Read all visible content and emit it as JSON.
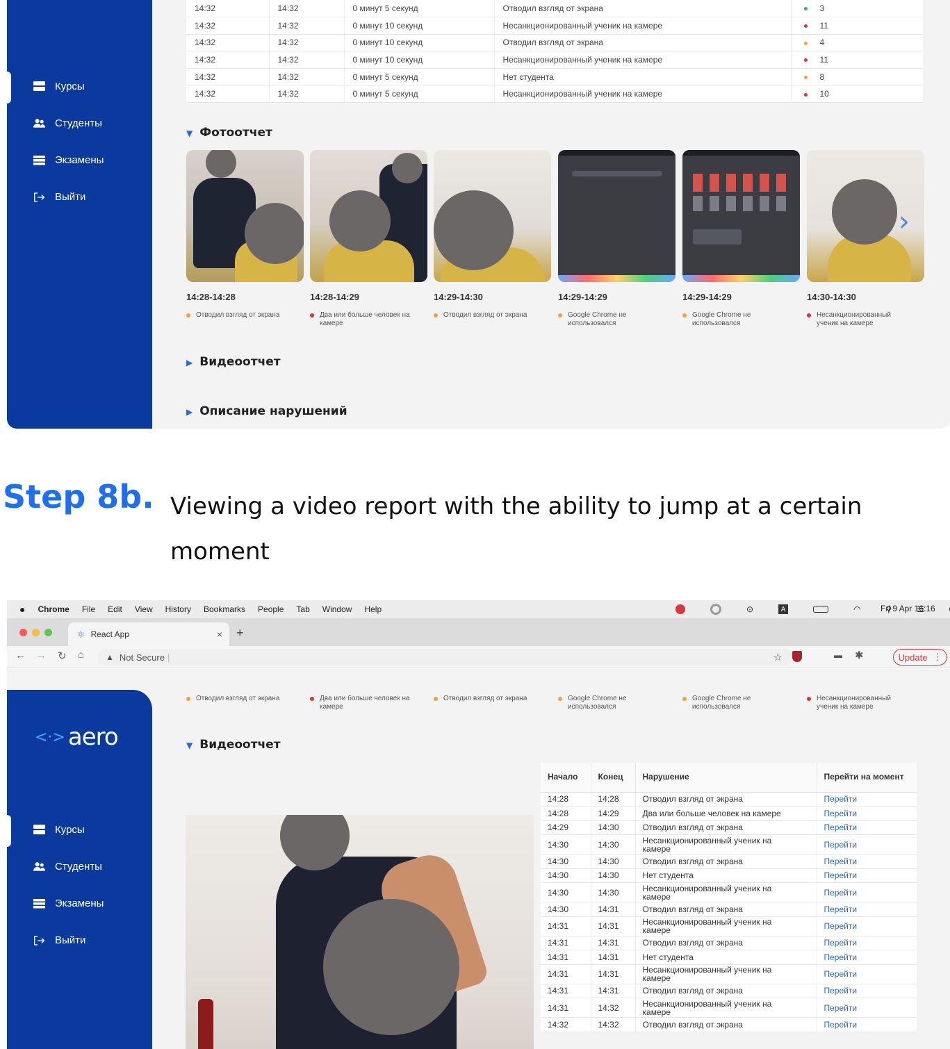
{
  "sidebar": {
    "items": [
      {
        "label": "Курсы",
        "icon": "courses-icon"
      },
      {
        "label": "Студенты",
        "icon": "students-icon"
      },
      {
        "label": "Экзамены",
        "icon": "exams-icon"
      },
      {
        "label": "Выйти",
        "icon": "logout-icon"
      }
    ],
    "logo": "aero",
    "logo_symbol": "<·>"
  },
  "violations_table": {
    "rows": [
      {
        "start": "14:32",
        "end": "14:32",
        "duration": "0 минут 5 секунд",
        "violation": "Отводил взгляд от экрана",
        "level": "green",
        "count": "3"
      },
      {
        "start": "14:32",
        "end": "14:32",
        "duration": "0 минут 10 секунд",
        "violation": "Несанкционированный ученик на камере",
        "level": "red",
        "count": "11"
      },
      {
        "start": "14:32",
        "end": "14:32",
        "duration": "0 минут 10 секунд",
        "violation": "Отводил взгляд от экрана",
        "level": "orange",
        "count": "4"
      },
      {
        "start": "14:32",
        "end": "14:32",
        "duration": "0 минут 10 секунд",
        "violation": "Несанкционированный ученик на камере",
        "level": "red",
        "count": "11"
      },
      {
        "start": "14:32",
        "end": "14:32",
        "duration": "0 минут 5 секунд",
        "violation": "Нет студента",
        "level": "orange",
        "count": "8"
      },
      {
        "start": "14:32",
        "end": "14:32",
        "duration": "0 минут 5 секунд",
        "violation": "Несанкционированный ученик на камере",
        "level": "red",
        "count": "10"
      }
    ]
  },
  "photo_report": {
    "title": "Фотоотчет",
    "items": [
      {
        "time": "14:28-14:28",
        "text": "Отводил взгляд от экрана",
        "level": "orange"
      },
      {
        "time": "14:28-14:29",
        "text": "Два или больше человек на камере",
        "level": "red"
      },
      {
        "time": "14:29-14:30",
        "text": "Отводил взгляд от экрана",
        "level": "orange"
      },
      {
        "time": "14:29-14:29",
        "text": "Google Chrome не использовался",
        "level": "orange"
      },
      {
        "time": "14:29-14:29",
        "text": "Google Chrome не использовался",
        "level": "orange"
      },
      {
        "time": "14:30-14:30",
        "text": "Несанкционированный ученик на камере",
        "level": "red"
      }
    ]
  },
  "sections": {
    "video_report": "Видеоотчет",
    "violations_description": "Описание нарушений"
  },
  "step": {
    "label": "Step 8b.",
    "description": "Viewing a video report with the ability to jump at a certain moment"
  },
  "menubar": {
    "items": [
      "Chrome",
      "File",
      "Edit",
      "View",
      "History",
      "Bookmarks",
      "People",
      "Tab",
      "Window",
      "Help"
    ],
    "clock": "Fri 9 Apr  16:16"
  },
  "browser": {
    "tab_title": "React App",
    "security": "Not Secure",
    "update_label": "Update"
  },
  "captions_strip": [
    {
      "text": "Отводил взгляд от экрана",
      "level": "orange"
    },
    {
      "text": "Два или больше человек на камере",
      "level": "red"
    },
    {
      "text": "Отводил взгляд от экрана",
      "level": "orange"
    },
    {
      "text": "Google Chrome не использовался",
      "level": "orange"
    },
    {
      "text": "Google Chrome не использовался",
      "level": "orange"
    },
    {
      "text": "Несанкционированный ученик на камере",
      "level": "red"
    }
  ],
  "jump_table": {
    "headers": [
      "Начало",
      "Конец",
      "Нарушение",
      "Перейти на момент"
    ],
    "link_label": "Перейти",
    "rows": [
      {
        "start": "14:28",
        "end": "14:28",
        "violation": "Отводил взгляд от экрана"
      },
      {
        "start": "14:28",
        "end": "14:29",
        "violation": "Два или больше человек на камере"
      },
      {
        "start": "14:29",
        "end": "14:30",
        "violation": "Отводил взгляд от экрана"
      },
      {
        "start": "14:30",
        "end": "14:30",
        "violation": "Несанкционированный ученик на камере"
      },
      {
        "start": "14:30",
        "end": "14:30",
        "violation": "Отводил взгляд от экрана"
      },
      {
        "start": "14:30",
        "end": "14:30",
        "violation": "Нет студента"
      },
      {
        "start": "14:30",
        "end": "14:30",
        "violation": "Несанкционированный ученик на камере"
      },
      {
        "start": "14:30",
        "end": "14:31",
        "violation": "Отводил взгляд от экрана"
      },
      {
        "start": "14:31",
        "end": "14:31",
        "violation": "Несанкционированный ученик на камере"
      },
      {
        "start": "14:31",
        "end": "14:31",
        "violation": "Отводил взгляд от экрана"
      },
      {
        "start": "14:31",
        "end": "14:31",
        "violation": "Нет студента"
      },
      {
        "start": "14:31",
        "end": "14:31",
        "violation": "Несанкционированный ученик на камере"
      },
      {
        "start": "14:31",
        "end": "14:31",
        "violation": "Отводил взгляд от экрана"
      },
      {
        "start": "14:31",
        "end": "14:32",
        "violation": "Несанкционированный ученик на камере"
      },
      {
        "start": "14:32",
        "end": "14:32",
        "violation": "Отводил взгляд от экрана"
      }
    ]
  },
  "colors": {
    "sidebar": "#0b3a9e",
    "accent": "#1d6ff0",
    "link": "#2a6ad8",
    "red": "#d9363e",
    "orange": "#f0a33a",
    "green": "#2fb36d"
  }
}
